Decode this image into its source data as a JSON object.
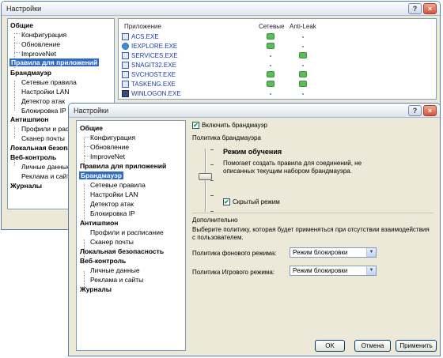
{
  "back_window": {
    "title": "Настройки",
    "title_buttons": {
      "help": "?",
      "close": "×"
    },
    "nav": [
      "Общие",
      "Конфигурация",
      "Обновление",
      "ImproveNet",
      "Правила для приложений",
      "Брандмауэр",
      "Сетевые правила",
      "Настройки LAN",
      "Детектор атак",
      "Блокировка IP",
      "Антишпион",
      "Профили и распис",
      "Сканер почты",
      "Локальная безопасн",
      "Веб-контроль",
      "Личные данные",
      "Реклама и сайты",
      "Журналы"
    ],
    "nav_selected_index": 4,
    "table": {
      "headers": {
        "app": "Приложение",
        "network": "Сетевые",
        "antileak": "Anti-Leak"
      },
      "rows": [
        {
          "name": "ACS.EXE",
          "icon": "app-window-icon",
          "network": true,
          "antileak": false
        },
        {
          "name": "IEXPLORE.EXE",
          "icon": "ie-icon",
          "network": true,
          "antileak": false
        },
        {
          "name": "SERVICES.EXE",
          "icon": "app-window-icon",
          "network": false,
          "antileak": true
        },
        {
          "name": "SNAGIT32.EXE",
          "icon": "snagit-icon",
          "network": false,
          "antileak": false
        },
        {
          "name": "SVCHOST.EXE",
          "icon": "app-window-icon",
          "network": true,
          "antileak": true
        },
        {
          "name": "TASKENG.EXE",
          "icon": "app-window-icon",
          "network": true,
          "antileak": true
        },
        {
          "name": "WINLOGON.EXE",
          "icon": "winlogon-icon",
          "network": false,
          "antileak": false
        }
      ]
    }
  },
  "front_window": {
    "title": "Настройки",
    "title_buttons": {
      "help": "?",
      "close": "×"
    },
    "nav": [
      "Общие",
      "Конфигурация",
      "Обновление",
      "ImproveNet",
      "Правила для приложений",
      "Брандмауэр",
      "Сетевые правила",
      "Настройки LAN",
      "Детектор атак",
      "Блокировка IP",
      "Антишпион",
      "Профили и расписание",
      "Сканер почты",
      "Локальная безопасность",
      "Веб-контроль",
      "Личные данные",
      "Реклама и сайты",
      "Журналы"
    ],
    "nav_selected_index": 5,
    "enable_firewall": {
      "label": "Включить брандмауэр",
      "checked": true
    },
    "policy_label": "Политика брандмауэра",
    "mode": {
      "title": "Режим обучения",
      "description": "Помогает создать правила для соединений, не описанных текущим набором брандмауэра.",
      "level": 0.5
    },
    "stealth": {
      "label": "Скрытый режим",
      "checked": true
    },
    "advanced": {
      "title": "Дополнительно",
      "description": "Выберите политику, которая будет применяться при отсутствии взаимодействия с пользователем.",
      "background_policy": {
        "label": "Политика фонового режима:",
        "value": "Режим блокировки"
      },
      "game_policy": {
        "label": "Политика Игрового режима:",
        "value": "Режим блокировки"
      }
    },
    "buttons": {
      "ok": "OK",
      "cancel": "Отмена",
      "apply": "Применить"
    }
  }
}
